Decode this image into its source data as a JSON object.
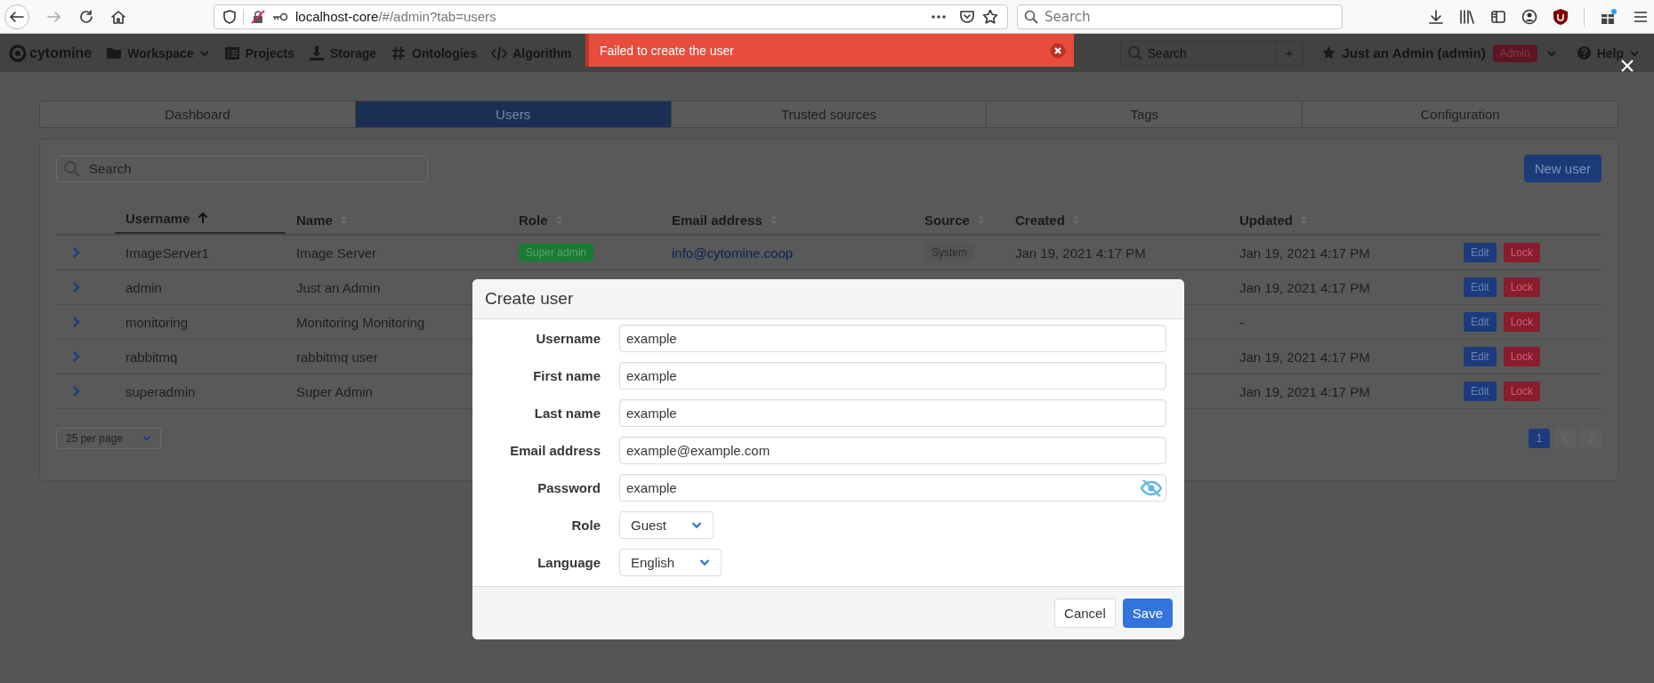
{
  "browser": {
    "url_host": "localhost-core",
    "url_path": "/#/admin?tab=users",
    "search_placeholder": "Search"
  },
  "navbar": {
    "logo": "cytomine",
    "items": [
      {
        "label": "Workspace",
        "dropdown": true
      },
      {
        "label": "Projects",
        "dropdown": false
      },
      {
        "label": "Storage",
        "dropdown": false
      },
      {
        "label": "Ontologies",
        "dropdown": false
      },
      {
        "label": "Algorithm",
        "dropdown": false
      }
    ],
    "search_placeholder": "Search",
    "add_button": "+",
    "user": "Just an Admin (admin)",
    "user_badge": "Admin",
    "help": "Help"
  },
  "toast": {
    "message": "Failed to create the user"
  },
  "tabs": [
    {
      "label": "Dashboard",
      "selected": false
    },
    {
      "label": "Users",
      "selected": true
    },
    {
      "label": "Trusted sources",
      "selected": false
    },
    {
      "label": "Tags",
      "selected": false
    },
    {
      "label": "Configuration",
      "selected": false
    }
  ],
  "search": {
    "placeholder": "Search"
  },
  "new_user_button": "New user",
  "table": {
    "columns": [
      {
        "label": "Username",
        "sorted": true
      },
      {
        "label": "Name",
        "sorted": false
      },
      {
        "label": "Role",
        "sorted": false
      },
      {
        "label": "Email address",
        "sorted": false
      },
      {
        "label": "Source",
        "sorted": false
      },
      {
        "label": "Created",
        "sorted": false
      },
      {
        "label": "Updated",
        "sorted": false
      }
    ],
    "rows": [
      {
        "expanded": false,
        "username": "ImageServer1",
        "name": "Image Server",
        "role": "Super admin",
        "email": "info@cytomine.coop",
        "source": "System",
        "created": "Jan 19, 2021 4:17 PM",
        "updated": "Jan 19, 2021 4:17 PM",
        "actions": [
          "Edit",
          "Lock"
        ]
      },
      {
        "expanded": false,
        "username": "admin",
        "name": "Just an Admin",
        "updated": "Jan 19, 2021 4:17 PM",
        "actions": [
          "Edit",
          "Lock"
        ]
      },
      {
        "expanded": false,
        "username": "monitoring",
        "name": "Monitoring Monitoring",
        "updated": "-",
        "actions": [
          "Edit",
          "Lock"
        ]
      },
      {
        "expanded": false,
        "username": "rabbitmq",
        "name": "rabbitmq user",
        "updated": "Jan 19, 2021 4:17 PM",
        "actions": [
          "Edit",
          "Lock"
        ]
      },
      {
        "expanded": false,
        "username": "superadmin",
        "name": "Super Admin",
        "updated": "Jan 19, 2021 4:17 PM",
        "actions": [
          "Edit",
          "Lock"
        ]
      }
    ]
  },
  "per_page": "25 per page",
  "pagination": {
    "pages": [
      {
        "label": "1",
        "selected": true
      }
    ]
  },
  "modal": {
    "title": "Create user",
    "fields": [
      {
        "kind": "text",
        "label": "Username",
        "value": "example"
      },
      {
        "kind": "text",
        "label": "First name",
        "value": "example"
      },
      {
        "kind": "text",
        "label": "Last name",
        "value": "example"
      },
      {
        "kind": "text",
        "label": "Email address",
        "value": "example@example.com"
      },
      {
        "kind": "password",
        "label": "Password",
        "value": "example"
      },
      {
        "kind": "select",
        "label": "Role",
        "value": "Guest"
      },
      {
        "kind": "select",
        "label": "Language",
        "value": "English"
      }
    ],
    "buttons": [
      {
        "kind": "secondary",
        "label": "Cancel"
      },
      {
        "kind": "primary",
        "label": "Save"
      }
    ]
  }
}
